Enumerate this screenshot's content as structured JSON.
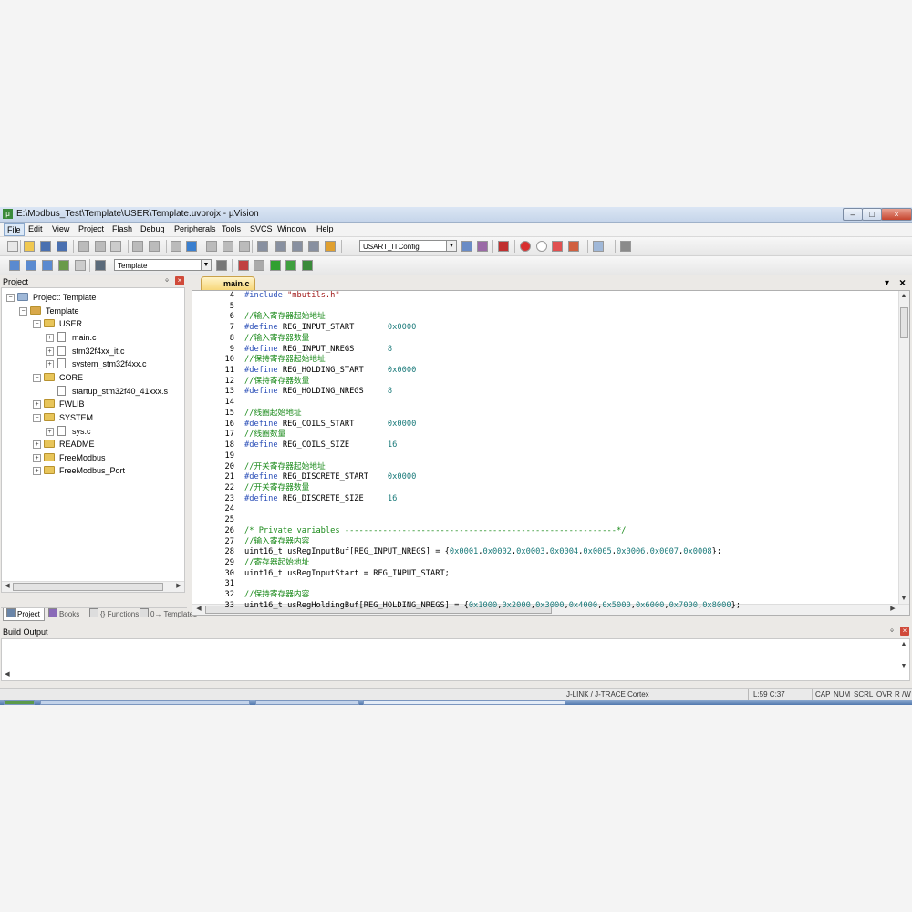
{
  "window": {
    "title": "E:\\Modbus_Test\\Template\\USER\\Template.uvprojx - µVision",
    "controls": {
      "minimize": "–",
      "maximize": "□",
      "close": "×"
    }
  },
  "menu": [
    "File",
    "Edit",
    "View",
    "Project",
    "Flash",
    "Debug",
    "Peripherals",
    "Tools",
    "SVCS",
    "Window",
    "Help"
  ],
  "toolbar1": {
    "find_combo": "USART_ITConfig"
  },
  "toolbar2": {
    "target_combo": "Template"
  },
  "project_panel": {
    "title": "Project",
    "pin": "ᛜ",
    "close": "×",
    "tree": [
      {
        "label": "Project: Template",
        "depth": 0,
        "type": "project",
        "expander": "−"
      },
      {
        "label": "Template",
        "depth": 1,
        "type": "target",
        "expander": "−"
      },
      {
        "label": "USER",
        "depth": 2,
        "type": "folder",
        "expander": "−"
      },
      {
        "label": "main.c",
        "depth": 3,
        "type": "file",
        "expander": "+"
      },
      {
        "label": "stm32f4xx_it.c",
        "depth": 3,
        "type": "file",
        "expander": "+"
      },
      {
        "label": "system_stm32f4xx.c",
        "depth": 3,
        "type": "file",
        "expander": "+"
      },
      {
        "label": "CORE",
        "depth": 2,
        "type": "folder",
        "expander": "−"
      },
      {
        "label": "startup_stm32f40_41xxx.s",
        "depth": 3,
        "type": "file",
        "expander": ""
      },
      {
        "label": "FWLIB",
        "depth": 2,
        "type": "folder",
        "expander": "+"
      },
      {
        "label": "SYSTEM",
        "depth": 2,
        "type": "folder",
        "expander": "−"
      },
      {
        "label": "sys.c",
        "depth": 3,
        "type": "file",
        "expander": "+"
      },
      {
        "label": "README",
        "depth": 2,
        "type": "folder",
        "expander": "+"
      },
      {
        "label": "FreeModbus",
        "depth": 2,
        "type": "folder",
        "expander": "+"
      },
      {
        "label": "FreeModbus_Port",
        "depth": 2,
        "type": "folder",
        "expander": "+"
      }
    ],
    "tabs": [
      "Project",
      "Books",
      "{} Functions",
      "0→ Templates"
    ]
  },
  "editor": {
    "tab": "main.c",
    "tab_menu": "▾",
    "tab_close": "×",
    "lines": [
      {
        "n": "4",
        "parts": [
          {
            "t": "#include ",
            "c": "kw"
          },
          {
            "t": "\"mbutils.h\"",
            "c": "str"
          }
        ]
      },
      {
        "n": "5",
        "parts": []
      },
      {
        "n": "6",
        "parts": [
          {
            "t": "//输入寄存器起始地址",
            "c": "cm"
          }
        ]
      },
      {
        "n": "7",
        "parts": [
          {
            "t": "#define ",
            "c": "kw"
          },
          {
            "t": "REG_INPUT_START       ",
            "c": ""
          },
          {
            "t": "0x0000",
            "c": "num"
          }
        ]
      },
      {
        "n": "8",
        "parts": [
          {
            "t": "//输入寄存器数量",
            "c": "cm"
          }
        ]
      },
      {
        "n": "9",
        "parts": [
          {
            "t": "#define ",
            "c": "kw"
          },
          {
            "t": "REG_INPUT_NREGS       ",
            "c": ""
          },
          {
            "t": "8",
            "c": "num"
          }
        ]
      },
      {
        "n": "10",
        "parts": [
          {
            "t": "//保持寄存器起始地址",
            "c": "cm"
          }
        ]
      },
      {
        "n": "11",
        "parts": [
          {
            "t": "#define ",
            "c": "kw"
          },
          {
            "t": "REG_HOLDING_START     ",
            "c": ""
          },
          {
            "t": "0x0000",
            "c": "num"
          }
        ]
      },
      {
        "n": "12",
        "parts": [
          {
            "t": "//保持寄存器数量",
            "c": "cm"
          }
        ]
      },
      {
        "n": "13",
        "parts": [
          {
            "t": "#define ",
            "c": "kw"
          },
          {
            "t": "REG_HOLDING_NREGS     ",
            "c": ""
          },
          {
            "t": "8",
            "c": "num"
          }
        ]
      },
      {
        "n": "14",
        "parts": []
      },
      {
        "n": "15",
        "parts": [
          {
            "t": "//线圈起始地址",
            "c": "cm"
          }
        ]
      },
      {
        "n": "16",
        "parts": [
          {
            "t": "#define ",
            "c": "kw"
          },
          {
            "t": "REG_COILS_START       ",
            "c": ""
          },
          {
            "t": "0x0000",
            "c": "num"
          }
        ]
      },
      {
        "n": "17",
        "parts": [
          {
            "t": "//线圈数量",
            "c": "cm"
          }
        ]
      },
      {
        "n": "18",
        "parts": [
          {
            "t": "#define ",
            "c": "kw"
          },
          {
            "t": "REG_COILS_SIZE        ",
            "c": ""
          },
          {
            "t": "16",
            "c": "num"
          }
        ]
      },
      {
        "n": "19",
        "parts": []
      },
      {
        "n": "20",
        "parts": [
          {
            "t": "//开关寄存器起始地址",
            "c": "cm"
          }
        ]
      },
      {
        "n": "21",
        "parts": [
          {
            "t": "#define ",
            "c": "kw"
          },
          {
            "t": "REG_DISCRETE_START    ",
            "c": ""
          },
          {
            "t": "0x0000",
            "c": "num"
          }
        ]
      },
      {
        "n": "22",
        "parts": [
          {
            "t": "//开关寄存器数量",
            "c": "cm"
          }
        ]
      },
      {
        "n": "23",
        "parts": [
          {
            "t": "#define ",
            "c": "kw"
          },
          {
            "t": "REG_DISCRETE_SIZE     ",
            "c": ""
          },
          {
            "t": "16",
            "c": "num"
          }
        ]
      },
      {
        "n": "24",
        "parts": []
      },
      {
        "n": "25",
        "parts": []
      },
      {
        "n": "26",
        "parts": [
          {
            "t": "/* Private variables ---------------------------------------------------------*/",
            "c": "cm"
          }
        ]
      },
      {
        "n": "27",
        "parts": [
          {
            "t": "//输入寄存器内容",
            "c": "cm"
          }
        ]
      },
      {
        "n": "28",
        "parts": [
          {
            "t": "uint16_t usRegInputBuf[REG_INPUT_NREGS] = {",
            "c": ""
          },
          {
            "t": "0x0001",
            "c": "num"
          },
          {
            "t": ",",
            "c": ""
          },
          {
            "t": "0x0002",
            "c": "num"
          },
          {
            "t": ",",
            "c": ""
          },
          {
            "t": "0x0003",
            "c": "num"
          },
          {
            "t": ",",
            "c": ""
          },
          {
            "t": "0x0004",
            "c": "num"
          },
          {
            "t": ",",
            "c": ""
          },
          {
            "t": "0x0005",
            "c": "num"
          },
          {
            "t": ",",
            "c": ""
          },
          {
            "t": "0x0006",
            "c": "num"
          },
          {
            "t": ",",
            "c": ""
          },
          {
            "t": "0x0007",
            "c": "num"
          },
          {
            "t": ",",
            "c": ""
          },
          {
            "t": "0x0008",
            "c": "num"
          },
          {
            "t": "};",
            "c": ""
          }
        ]
      },
      {
        "n": "29",
        "parts": [
          {
            "t": "//寄存器起始地址",
            "c": "cm"
          }
        ]
      },
      {
        "n": "30",
        "parts": [
          {
            "t": "uint16_t usRegInputStart = REG_INPUT_START;",
            "c": ""
          }
        ]
      },
      {
        "n": "31",
        "parts": []
      },
      {
        "n": "32",
        "parts": [
          {
            "t": "//保持寄存器内容",
            "c": "cm"
          }
        ]
      },
      {
        "n": "33",
        "parts": [
          {
            "t": "uint16_t usRegHoldingBuf[REG_HOLDING_NREGS] = {",
            "c": ""
          },
          {
            "t": "0x1000",
            "c": "num"
          },
          {
            "t": ",",
            "c": ""
          },
          {
            "t": "0x2000",
            "c": "num"
          },
          {
            "t": ",",
            "c": ""
          },
          {
            "t": "0x3000",
            "c": "num"
          },
          {
            "t": ",",
            "c": ""
          },
          {
            "t": "0x4000",
            "c": "num"
          },
          {
            "t": ",",
            "c": ""
          },
          {
            "t": "0x5000",
            "c": "num"
          },
          {
            "t": ",",
            "c": ""
          },
          {
            "t": "0x6000",
            "c": "num"
          },
          {
            "t": ",",
            "c": ""
          },
          {
            "t": "0x7000",
            "c": "num"
          },
          {
            "t": ",",
            "c": ""
          },
          {
            "t": "0x8000",
            "c": "num"
          },
          {
            "t": "};",
            "c": ""
          }
        ]
      }
    ]
  },
  "build_output": {
    "title": "Build Output",
    "pin": "ᛜ",
    "close": "×"
  },
  "statusbar": {
    "debugger": "J-LINK / J-TRACE Cortex",
    "position": "L:59 C:37",
    "indicators": [
      "CAP",
      "NUM",
      "SCRL",
      "OVR",
      "R /W"
    ]
  },
  "colors": {
    "comment": "#1a8a1a",
    "keyword": "#2b4fb8",
    "number": "#1a7a7a",
    "string": "#a01a1a",
    "tab_active": "#f7d77a"
  }
}
